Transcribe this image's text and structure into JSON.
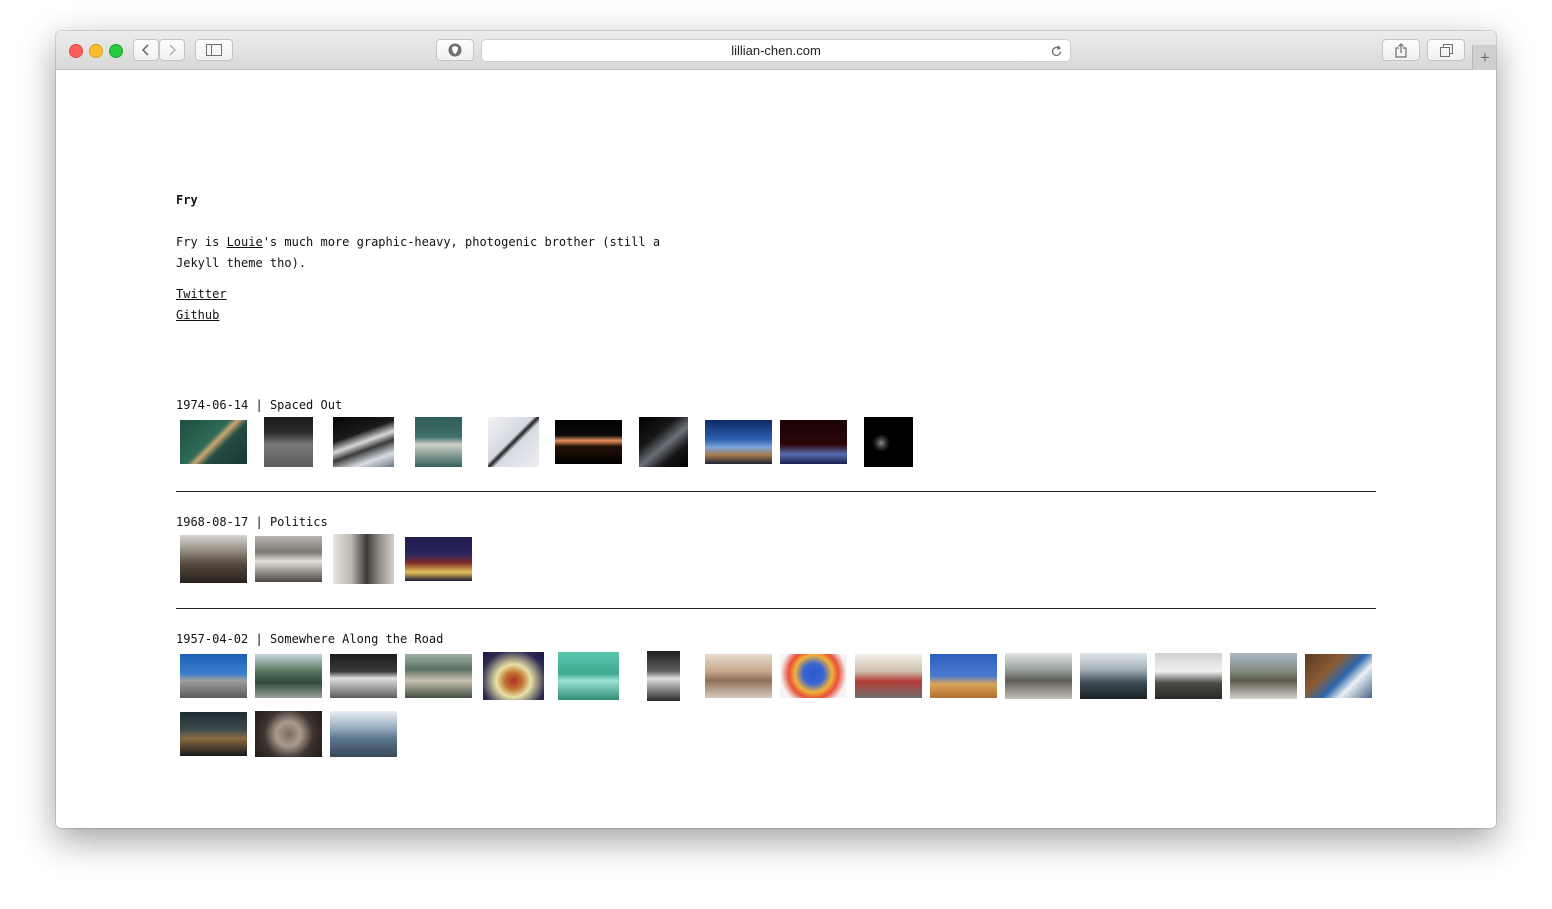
{
  "browser": {
    "url": "lillian-chen.com"
  },
  "page": {
    "title": "Fry",
    "intro": {
      "lead": "Fry is ",
      "link_text": "Louie",
      "tail": "'s much more graphic-heavy, photogenic brother (still a Jekyll theme tho)."
    },
    "links": [
      {
        "label": "Twitter"
      },
      {
        "label": "Github"
      }
    ]
  },
  "posts": [
    {
      "date": "1974-06-14",
      "title": "Spaced Out",
      "photos": [
        {
          "w": 67,
          "h": 44,
          "bg": "linear-gradient(135deg,#1f4d43 0%,#2d6b55 45%,#caa870 52%,#234c44 62%,#163a35 100%)"
        },
        {
          "w": 49,
          "h": 50,
          "bg": "linear-gradient(180deg,#1a1a1a 0%,#2b2b2b 30%,#777 55%,#5d5d5d 100%)"
        },
        {
          "w": 61,
          "h": 50,
          "bg": "linear-gradient(160deg,#050505 0%,#1b1b1b 35%,#d8d8d8 50%,#3a3a3a 62%,#d9dde3 80%,#6a7584 100%)"
        },
        {
          "w": 47,
          "h": 50,
          "bg": "linear-gradient(180deg,#2f5d57 0%,#3f706a 40%,#cfd2c9 55%,#36605a 100%)"
        },
        {
          "w": 51,
          "h": 50,
          "bg": "linear-gradient(135deg,#f1f2f5 0%,#d6d9e1 45%,#1e1e1e 50%,#d8dbe3 56%,#eceef2 100%)"
        },
        {
          "w": 67,
          "h": 44,
          "bg": "linear-gradient(180deg,#000 0%,#0c0c0c 35%,#e9905a 47%,#241208 60%,#000 100%)"
        },
        {
          "w": 49,
          "h": 50,
          "bg": "linear-gradient(140deg,#000 0%,#171717 35%,#6b6f77 55%,#141414 75%,#000 100%)"
        },
        {
          "w": 67,
          "h": 44,
          "bg": "linear-gradient(180deg,#0d2a64 0%,#2f62b3 45%,#7da6d9 62%,#a57949 80%,#1c2233 100%)"
        },
        {
          "w": 67,
          "h": 44,
          "bg": "linear-gradient(180deg,#1a0405 0%,#2a0606 55%,#5a6bb1 78%,#171f4d 100%)"
        },
        {
          "w": 49,
          "h": 50,
          "bg": "radial-gradient(circle at 35% 52%,#8a8a8a 0,#2e2e2e 5px,#000 9px,#000 100%)"
        }
      ]
    },
    {
      "date": "1968-08-17",
      "title": "Politics",
      "photos": [
        {
          "w": 67,
          "h": 48,
          "bg": "linear-gradient(180deg,#d6d6d6 0%,#9a9288 30%,#574a3f 60%,#27211c 100%)"
        },
        {
          "w": 67,
          "h": 46,
          "bg": "linear-gradient(180deg,#b6b6b6 0%,#7d7770 35%,#e5e1da 55%,#4a4540 100%)"
        },
        {
          "w": 61,
          "h": 50,
          "bg": "linear-gradient(90deg,#e8e5df 0%,#bcb7b0 30%,#3c3a37 55%,#8f8a83 75%,#d5d1ca 100%)"
        },
        {
          "w": 67,
          "h": 44,
          "bg": "linear-gradient(180deg,#1f1b4b 0%,#2c2660 40%,#7b2a2a 58%,#e6c15a 80%,#1b1733 100%)"
        }
      ]
    },
    {
      "date": "1957-04-02",
      "title": "Somewhere Along the Road",
      "photos": [
        {
          "w": 67,
          "h": 44,
          "bg": "linear-gradient(180deg,#1a5fb5 0%,#3c7fcc 45%,#9d9f9c 60%,#5a5c5a 100%)"
        },
        {
          "w": 67,
          "h": 44,
          "bg": "linear-gradient(180deg,#c8d8dc 0%,#53755e 40%,#2f4b37 65%,#9aa19b 100%)"
        },
        {
          "w": 67,
          "h": 44,
          "bg": "linear-gradient(180deg,#1d1d1d 0%,#3a3a3a 40%,#e0e0e0 55%,#5c5c5c 100%)"
        },
        {
          "w": 67,
          "h": 44,
          "bg": "linear-gradient(180deg,#9fb2a5 0%,#5c7260 35%,#c9c2b3 60%,#415041 100%)"
        },
        {
          "w": 61,
          "h": 48,
          "bg": "radial-gradient(ellipse at 50% 60%,#b22d2a 0,#c0722f 20%,#e9e1a5 40%,#2d2b54 75%,#191740 100%)"
        },
        {
          "w": 61,
          "h": 48,
          "bg": "linear-gradient(180deg,#5cc7b0 0%,#3fa98f 45%,#9be2d4 60%,#2f8d74 100%)"
        },
        {
          "w": 33,
          "h": 50,
          "bg": "linear-gradient(180deg,#202020 0%,#5f5f5f 40%,#e0e0e0 55%,#2a2a2a 100%)"
        },
        {
          "w": 67,
          "h": 44,
          "bg": "linear-gradient(180deg,#e8dccb 0%,#c7a68a 40%,#8d6f59 60%,#d9cabb 100%)"
        },
        {
          "w": 67,
          "h": 44,
          "bg": "radial-gradient(circle at 50% 45%,#2c58c9 0,#3a66d4 25%,#f2b23a 45%,#e84f3a 60%,#f4f4f4 80%)"
        },
        {
          "w": 67,
          "h": 44,
          "bg": "linear-gradient(180deg,#f2f0ea 0%,#cdbdaa 40%,#b33a35 62%,#6f6e6c 100%)"
        },
        {
          "w": 67,
          "h": 44,
          "bg": "linear-gradient(180deg,#2c5fbd 0%,#4a7bd0 50%,#d9a35a 68%,#b07130 100%)"
        },
        {
          "w": 67,
          "h": 46,
          "bg": "linear-gradient(180deg,#e2e4e3 0%,#9aa39f 35%,#5f5d57 60%,#c3c0b9 100%)"
        },
        {
          "w": 67,
          "h": 46,
          "bg": "linear-gradient(180deg,#dfe6ea 0%,#a7b3bb 35%,#3b4a54 65%,#1c2226 100%)"
        },
        {
          "w": 67,
          "h": 46,
          "bg": "linear-gradient(180deg,#cfd0d1 0%,#f1f1f1 40%,#4d4b47 65%,#2a2825 100%)"
        },
        {
          "w": 67,
          "h": 46,
          "bg": "linear-gradient(180deg,#aeb9c8 0%,#7d8a7a 40%,#5d5a4d 60%,#d4d3cd 100%)"
        },
        {
          "w": 67,
          "h": 44,
          "bg": "linear-gradient(135deg,#5a3a26 0%,#8c5b33 35%,#2b66ad 55%,#edf0f4 70%,#44668a 100%)"
        },
        {
          "w": 67,
          "h": 44,
          "bg": "linear-gradient(180deg,#1e2c35 0%,#3e4b4d 40%,#8a6a41 60%,#16191a 100%)"
        },
        {
          "w": 67,
          "h": 46,
          "bg": "radial-gradient(circle at 50% 50%,#7d6a60 0,#aa9a8c 30%,#3e3430 60%,#1f1a18 100%)"
        },
        {
          "w": 67,
          "h": 46,
          "bg": "linear-gradient(180deg,#e8eef3 0%,#9cb1c2 35%,#5b7690 60%,#3a4856 100%)"
        }
      ]
    }
  ]
}
